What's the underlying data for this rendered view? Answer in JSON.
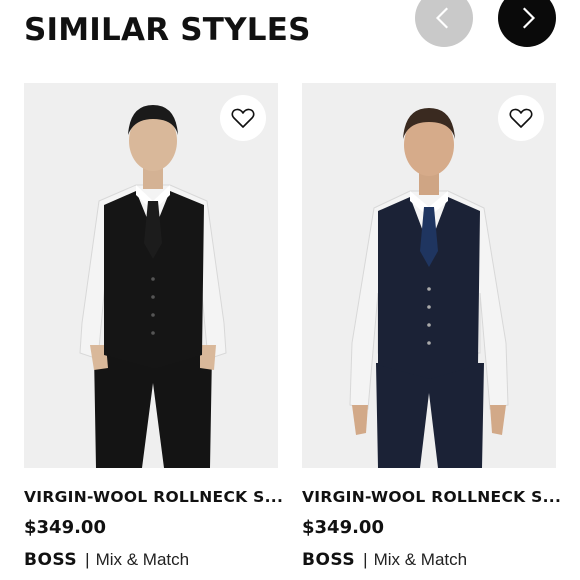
{
  "section": {
    "title": "SIMILAR STYLES",
    "prev_icon": "chevron-left-icon",
    "next_icon": "chevron-right-icon"
  },
  "products": [
    {
      "name": "VIRGIN-WOOL ROLLNECK S...",
      "price": "$349.00",
      "brand": "BOSS",
      "separator": "|",
      "collection": "Mix & Match",
      "favorite_icon": "heart-outline-icon",
      "tie_color": "#1c1c1c",
      "vest_color": "#151515"
    },
    {
      "name": "VIRGIN-WOOL ROLLNECK S...",
      "price": "$349.00",
      "brand": "BOSS",
      "separator": "|",
      "collection": "Mix & Match",
      "favorite_icon": "heart-outline-icon",
      "tie_color": "#1f3560",
      "vest_color": "#1b2236"
    }
  ],
  "colors": {
    "prev_button": "#c9c9c9",
    "next_button": "#0a0a0a",
    "photo_bg": "#efefef"
  }
}
